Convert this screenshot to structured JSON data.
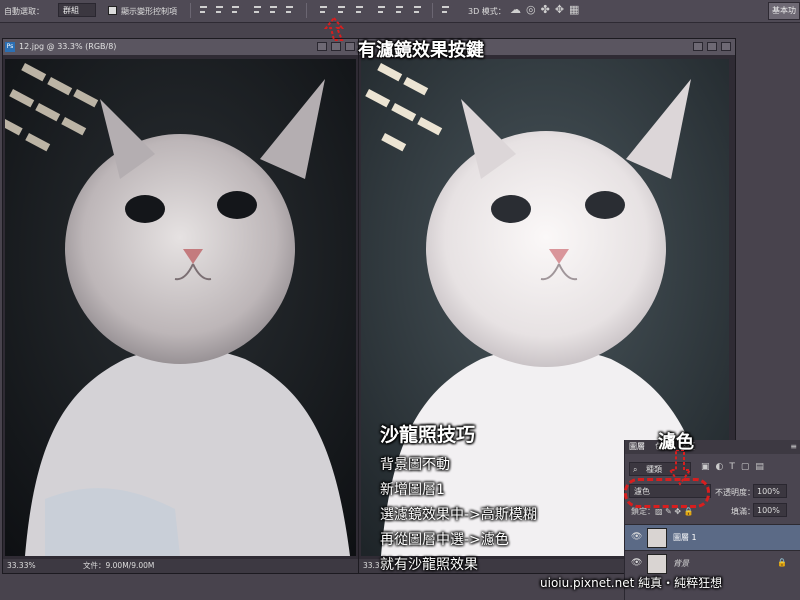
{
  "options_bar": {
    "auto_select_label": "自動選取：",
    "auto_select_value": "群組",
    "show_transform_label": "顯示變形控制項",
    "mode_3d_label": "3D 模式：",
    "workspace_label": "基本功"
  },
  "left_window": {
    "title": "12.jpg @ 33.3% (RGB/8)",
    "zoom": "33.33%",
    "doc_size": "文件：9.00M/9.00M"
  },
  "right_window": {
    "zoom": "33.33%"
  },
  "annotations": {
    "filter_button": "有濾鏡效果按鍵",
    "screen_label": "濾色",
    "steps_title": "沙龍照技巧",
    "steps": [
      "背景圖不動",
      "新增圖層1",
      "選濾鏡效果中->高斯模糊",
      "再從圖層中選->濾色",
      "就有沙龍照效果"
    ],
    "watermark": "uioiu.pixnet.net  純真・純粹狂想"
  },
  "layers_panel": {
    "tabs": [
      "圖層",
      "色版",
      "路徑"
    ],
    "filter_kind": "種類",
    "blend_mode": "濾色",
    "opacity_label": "不透明度：",
    "opacity_value": "100%",
    "fill_label": "填滿：",
    "fill_value": "100%",
    "layers": [
      {
        "name": "圖層 1",
        "selected": true
      },
      {
        "name": "背景",
        "selected": false
      }
    ]
  },
  "colors": {
    "annotation_red": "#d81e1e",
    "panel_bg": "#4a4550",
    "selected_layer": "#5b6a86"
  }
}
